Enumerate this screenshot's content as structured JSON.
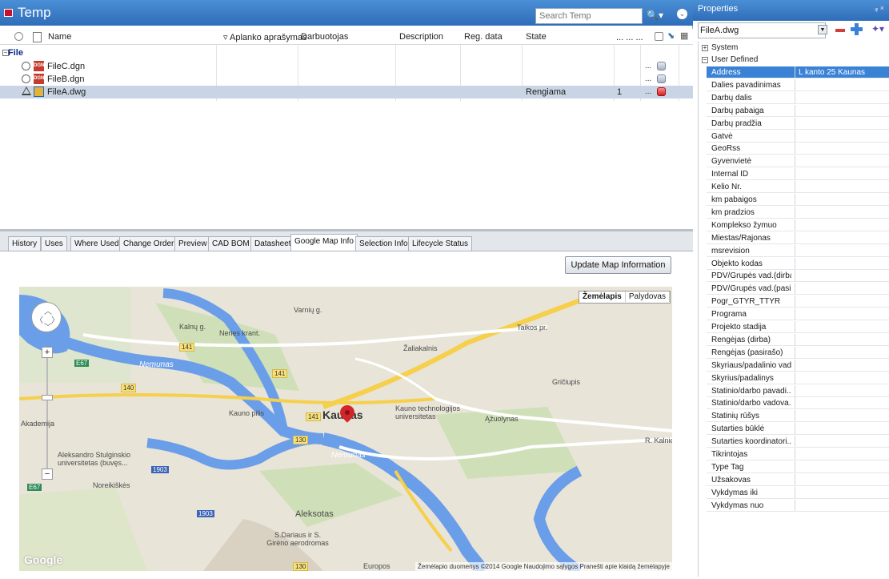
{
  "doc_pane": {
    "title": "Temp",
    "search_placeholder": "Search Temp",
    "columns": [
      "Name",
      "Aplanko aprašymas",
      "Darbuotojas",
      "Description",
      "Reg. data",
      "State"
    ],
    "col_dots": "... ... ...",
    "group_label": "File",
    "rows": [
      {
        "name": "FileC.dgn",
        "state": "",
        "rev": "",
        "dots": "..."
      },
      {
        "name": "FileB.dgn",
        "state": "",
        "rev": "",
        "dots": "..."
      },
      {
        "name": "FileA.dwg",
        "state": "Rengiama",
        "rev": "1",
        "dots": "..."
      }
    ]
  },
  "tabs": [
    "History",
    "Uses",
    "Where Used",
    "Change Order",
    "Preview",
    "CAD BOM",
    "Datasheet",
    "Google Map Info",
    "Selection Info",
    "Lifecycle Status"
  ],
  "active_tab": "Google Map Info",
  "map_panel": {
    "update_button": "Update Map Information",
    "map_type_buttons": [
      "Žemėlapis",
      "Palydovas"
    ],
    "city": "Kaunas",
    "labels": {
      "kauno_pilis": "Kauno pilis",
      "ktu": "Kauno technologijos universitetas",
      "azuolynas": "Ąžuolynas",
      "aleksotas": "Aleksotas",
      "akademija": "Akademija",
      "vdu": "Aleksandro Stulginskio universitetas (buvęs...",
      "noreikiskes": "Noreikiškės",
      "aerodromas": "S.Dariaus ir S. Girėno aerodromas",
      "griciupis": "Gričiupis",
      "nemunas": "Nemunas",
      "neris": "Neries krant.",
      "taikos": "Taikos pr.",
      "zaliakalnis": "Žaliakalnis",
      "variu": "Varnių g.",
      "kalnu": "Kalnų g.",
      "rkalnio": "R. Kalnio",
      "europos": "Europos"
    },
    "roads": {
      "r141": "141",
      "r140": "140",
      "r130": "130",
      "r1903": "1903",
      "e67": "E67"
    },
    "attribution": "Žemėlapio duomenys ©2014 Google   Naudojimo sąlygos   Pranešti apie klaidą žemėlapyje",
    "logo": "Google"
  },
  "properties": {
    "title": "Properties",
    "pin_glyph": "ᵩ ×",
    "selected_object": "FileA.dwg",
    "categories": [
      {
        "label": "System",
        "expanded": false
      },
      {
        "label": "User Defined",
        "expanded": true
      }
    ],
    "rows": [
      {
        "name": "Address",
        "value": "L kanto 25 Kaunas"
      },
      {
        "name": "Dalies pavadinimas",
        "value": ""
      },
      {
        "name": "Darbų dalis",
        "value": ""
      },
      {
        "name": "Darbų pabaiga",
        "value": ""
      },
      {
        "name": "Darbų pradžia",
        "value": ""
      },
      {
        "name": "Gatvė",
        "value": ""
      },
      {
        "name": "GeoRss",
        "value": ""
      },
      {
        "name": "Gyvenvietė",
        "value": ""
      },
      {
        "name": "Internal ID",
        "value": ""
      },
      {
        "name": "Kelio Nr.",
        "value": ""
      },
      {
        "name": "km pabaigos",
        "value": ""
      },
      {
        "name": "km pradzios",
        "value": ""
      },
      {
        "name": "Komplekso žymuo",
        "value": ""
      },
      {
        "name": "Miestas/Rajonas",
        "value": ""
      },
      {
        "name": "msrevision",
        "value": ""
      },
      {
        "name": "Objekto kodas",
        "value": ""
      },
      {
        "name": "PDV/Grupės vad.(dirba)",
        "value": ""
      },
      {
        "name": "PDV/Grupės vad.(pasir...",
        "value": ""
      },
      {
        "name": "Pogr_GTYR_TTYR",
        "value": ""
      },
      {
        "name": "Programa",
        "value": ""
      },
      {
        "name": "Projekto stadija",
        "value": ""
      },
      {
        "name": "Rengėjas (dirba)",
        "value": ""
      },
      {
        "name": "Rengėjas (pasirašo)",
        "value": ""
      },
      {
        "name": "Skyriaus/padalinio vad...",
        "value": ""
      },
      {
        "name": "Skyrius/padalinys",
        "value": ""
      },
      {
        "name": "Statinio/darbo pavadi...",
        "value": ""
      },
      {
        "name": "Statinio/darbo vadova...",
        "value": ""
      },
      {
        "name": "Statinių rūšys",
        "value": ""
      },
      {
        "name": "Sutarties būklė",
        "value": ""
      },
      {
        "name": "Sutarties koordinatori...",
        "value": ""
      },
      {
        "name": "Tikrintojas",
        "value": ""
      },
      {
        "name": "Type Tag",
        "value": ""
      },
      {
        "name": "Užsakovas",
        "value": ""
      },
      {
        "name": "Vykdymas iki",
        "value": ""
      },
      {
        "name": "Vykdymas nuo",
        "value": ""
      }
    ]
  },
  "colors": {
    "title_bar": "#2f6db8",
    "selection": "#3a82d6",
    "map_bg": "#e8e4d8",
    "river": "#6b9ee8"
  }
}
